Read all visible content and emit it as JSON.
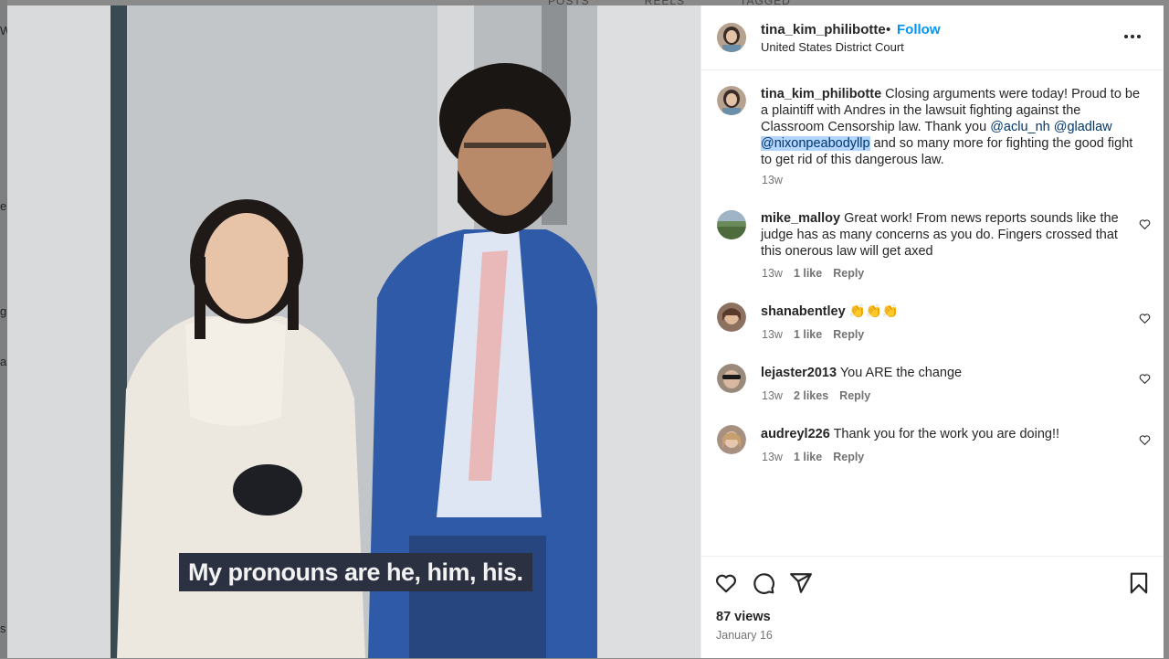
{
  "background": {
    "tabs": [
      "POSTS",
      "REELS",
      "TAGGED"
    ],
    "side_letters": [
      "W",
      "e",
      "g",
      "a",
      "s"
    ]
  },
  "video": {
    "caption": "My pronouns are he, him, his."
  },
  "post": {
    "username": "tina_kim_philibotte",
    "follow_label": "Follow",
    "location": "United States District Court",
    "caption": {
      "username": "tina_kim_philibotte",
      "text_before": "Closing arguments were today! Proud to be a plaintiff with Andres in the lawsuit fighting against the Classroom Censorship law. Thank you ",
      "mention_1": "@aclu_nh",
      "mention_2": "@gladlaw",
      "mention_3": "@nixonpeabodyllp",
      "text_after": " and so many more for fighting the good fight to get rid of this dangerous law.",
      "time": "13w"
    },
    "comments": [
      {
        "username": "mike_malloy",
        "text": "Great work! From news reports sounds like the judge has as many concerns as you do. Fingers crossed that this onerous law will get axed",
        "time": "13w",
        "likes": "1 like",
        "reply": "Reply"
      },
      {
        "username": "shanabentley",
        "text": "👏👏👏",
        "time": "13w",
        "likes": "1 like",
        "reply": "Reply"
      },
      {
        "username": "lejaster2013",
        "text": "You ARE the change",
        "time": "13w",
        "likes": "2 likes",
        "reply": "Reply"
      },
      {
        "username": "audreyl226",
        "text": "Thank you for the work you are doing!!",
        "time": "13w",
        "likes": "1 like",
        "reply": "Reply"
      }
    ],
    "views": "87 views",
    "date": "January 16"
  },
  "icons": {
    "more": "more-options-icon",
    "like": "heart-icon",
    "comment": "comment-icon",
    "share": "share-icon",
    "save": "bookmark-icon",
    "comment_like": "heart-outline-icon"
  },
  "colors": {
    "link": "#0095f6",
    "mention": "#00376b",
    "muted": "#737373",
    "text": "#262626",
    "selection": "#b4d5fe"
  }
}
